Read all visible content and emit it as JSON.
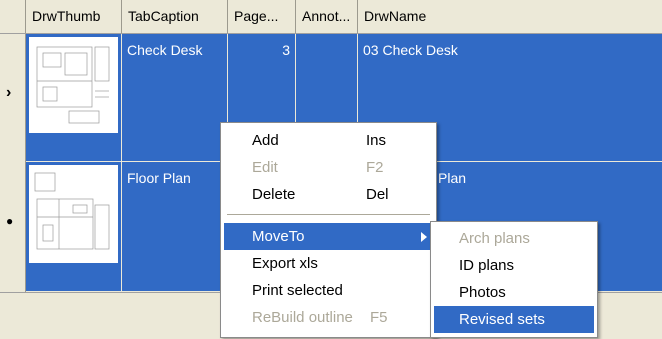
{
  "grid": {
    "columns": [
      "DrwThumb",
      "TabCaption",
      "Page...",
      "Annot...",
      "DrwName"
    ],
    "rows": [
      {
        "marker": "arrow",
        "tab_caption": "Check Desk",
        "page": "3",
        "annot": "",
        "drw_name": "03 Check Desk"
      },
      {
        "marker": "dot",
        "tab_caption": "Floor Plan",
        "page": "",
        "annot": "",
        "drw_name": "Plan"
      }
    ],
    "selection_color": "#316ac5"
  },
  "context_menu": {
    "items": [
      {
        "label": "Add",
        "shortcut": "Ins",
        "enabled": true
      },
      {
        "label": "Edit",
        "shortcut": "F2",
        "enabled": false
      },
      {
        "label": "Delete",
        "shortcut": "Del",
        "enabled": true
      },
      {
        "label": "MoveTo",
        "shortcut": "",
        "enabled": true,
        "highlighted": true,
        "has_submenu": true
      },
      {
        "label": "Export xls",
        "shortcut": "",
        "enabled": true
      },
      {
        "label": "Print selected",
        "shortcut": "",
        "enabled": true
      },
      {
        "label": "ReBuild outline",
        "shortcut": "F5",
        "enabled": false
      }
    ]
  },
  "submenu": {
    "items": [
      {
        "label": "Arch plans",
        "enabled": false
      },
      {
        "label": "ID plans",
        "enabled": true
      },
      {
        "label": "Photos",
        "enabled": true
      },
      {
        "label": "Revised sets",
        "enabled": true,
        "highlighted": true
      }
    ]
  }
}
